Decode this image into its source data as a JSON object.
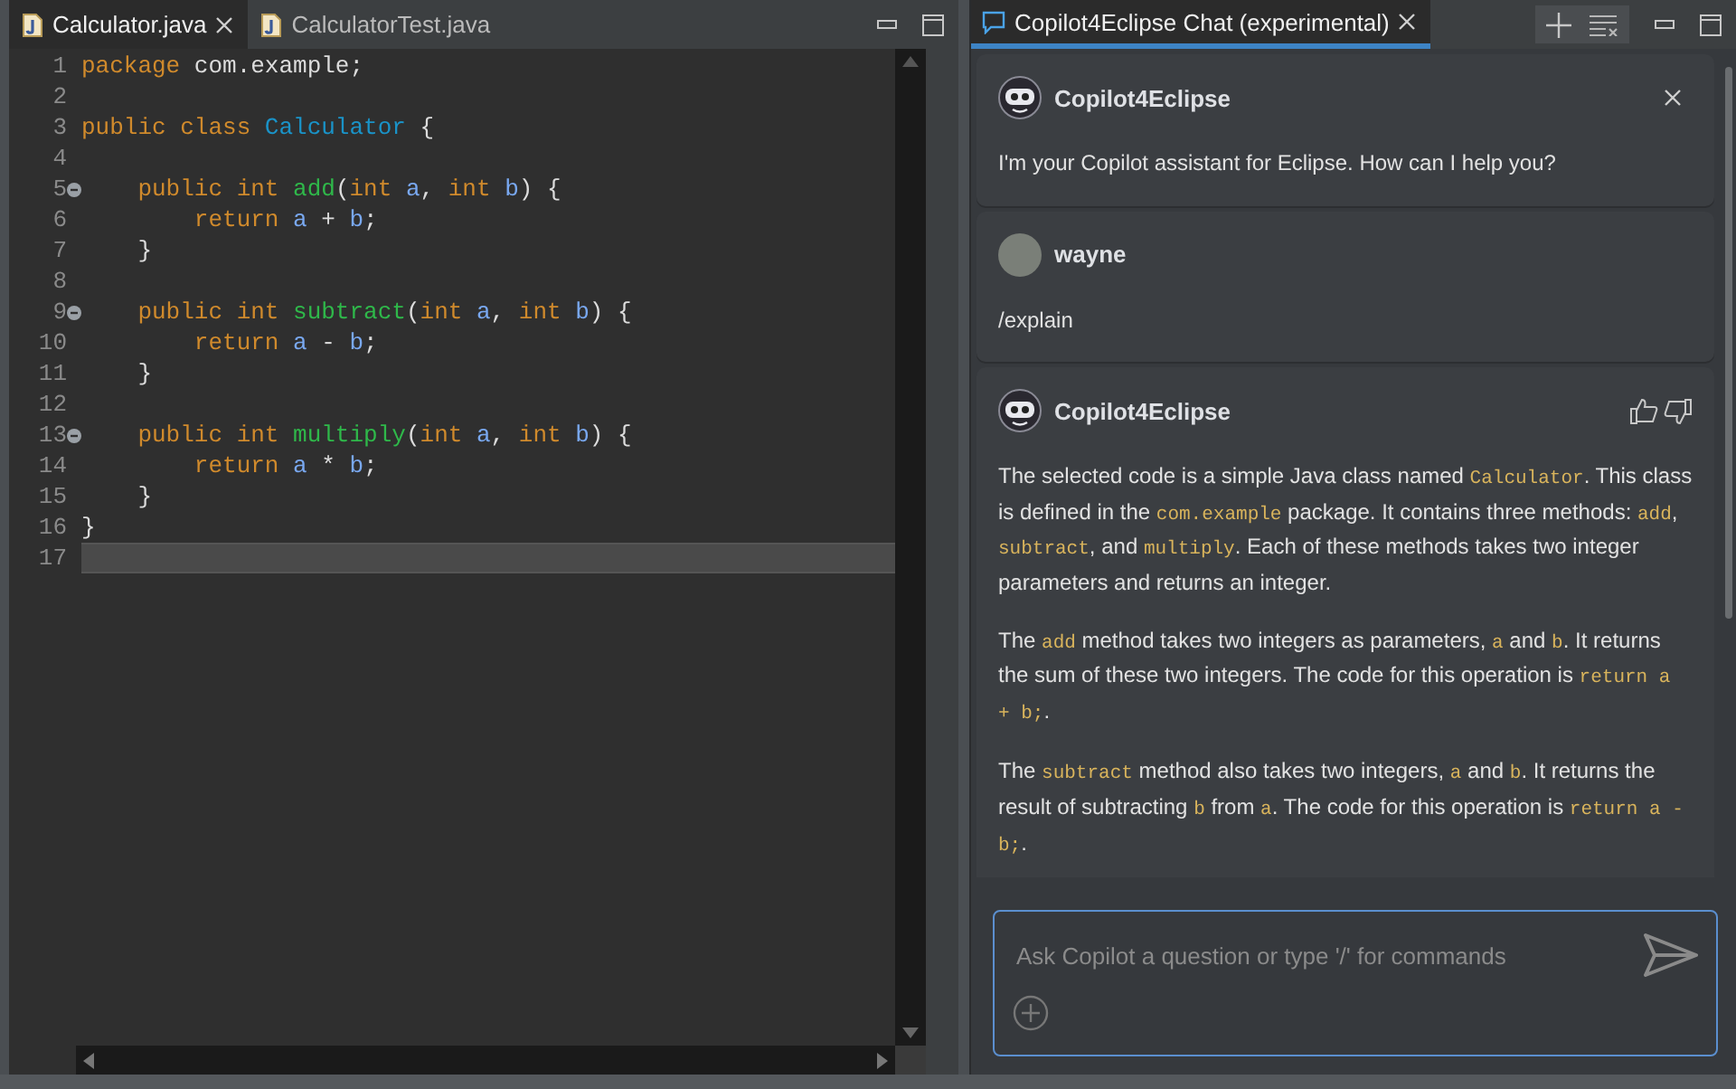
{
  "editor": {
    "tabs": [
      {
        "label": "Calculator.java",
        "selected": true
      },
      {
        "label": "CalculatorTest.java",
        "selected": false
      }
    ],
    "lines": [
      {
        "number": "1",
        "fold": false,
        "current": false,
        "tokens": [
          {
            "t": "package",
            "kind": "keyword"
          },
          {
            "t": " com.example;",
            "kind": "plain"
          }
        ]
      },
      {
        "number": "2",
        "fold": false,
        "current": false
      },
      {
        "number": "3",
        "fold": false,
        "current": false,
        "tokens": [
          {
            "t": "public class ",
            "kind": "keyword"
          },
          {
            "t": "Calculator",
            "kind": "classname"
          },
          {
            "t": " {",
            "kind": "plain"
          }
        ]
      },
      {
        "number": "4",
        "fold": false,
        "current": false
      },
      {
        "number": "5",
        "fold": true,
        "current": false,
        "tokens": [
          {
            "t": "    public int ",
            "kind": "keyword"
          },
          {
            "t": "add",
            "kind": "method"
          },
          {
            "t": "(",
            "kind": "plain"
          },
          {
            "t": "int",
            "kind": "keyword"
          },
          {
            "t": " a",
            "kind": "param"
          },
          {
            "t": ", ",
            "kind": "plain"
          },
          {
            "t": "int",
            "kind": "keyword"
          },
          {
            "t": " b",
            "kind": "param"
          },
          {
            "t": ") {",
            "kind": "plain"
          }
        ]
      },
      {
        "number": "6",
        "fold": false,
        "current": false,
        "tokens": [
          {
            "t": "        return",
            "kind": "keyword"
          },
          {
            "t": " a",
            "kind": "param"
          },
          {
            "t": " + ",
            "kind": "plain"
          },
          {
            "t": "b",
            "kind": "param"
          },
          {
            "t": ";",
            "kind": "plain"
          }
        ]
      },
      {
        "number": "7",
        "fold": false,
        "current": false,
        "tokens": [
          {
            "t": "    }",
            "kind": "plain"
          }
        ]
      },
      {
        "number": "8",
        "fold": false,
        "current": false
      },
      {
        "number": "9",
        "fold": true,
        "current": false,
        "tokens": [
          {
            "t": "    public int ",
            "kind": "keyword"
          },
          {
            "t": "subtract",
            "kind": "method"
          },
          {
            "t": "(",
            "kind": "plain"
          },
          {
            "t": "int",
            "kind": "keyword"
          },
          {
            "t": " a",
            "kind": "param"
          },
          {
            "t": ", ",
            "kind": "plain"
          },
          {
            "t": "int",
            "kind": "keyword"
          },
          {
            "t": " b",
            "kind": "param"
          },
          {
            "t": ") {",
            "kind": "plain"
          }
        ]
      },
      {
        "number": "10",
        "fold": false,
        "current": false,
        "tokens": [
          {
            "t": "        return",
            "kind": "keyword"
          },
          {
            "t": " a",
            "kind": "param"
          },
          {
            "t": " - ",
            "kind": "plain"
          },
          {
            "t": "b",
            "kind": "param"
          },
          {
            "t": ";",
            "kind": "plain"
          }
        ]
      },
      {
        "number": "11",
        "fold": false,
        "current": false,
        "tokens": [
          {
            "t": "    }",
            "kind": "plain"
          }
        ]
      },
      {
        "number": "12",
        "fold": false,
        "current": false
      },
      {
        "number": "13",
        "fold": true,
        "current": false,
        "tokens": [
          {
            "t": "    public int ",
            "kind": "keyword"
          },
          {
            "t": "multiply",
            "kind": "method"
          },
          {
            "t": "(",
            "kind": "plain"
          },
          {
            "t": "int",
            "kind": "keyword"
          },
          {
            "t": " a",
            "kind": "param"
          },
          {
            "t": ", ",
            "kind": "plain"
          },
          {
            "t": "int",
            "kind": "keyword"
          },
          {
            "t": " b",
            "kind": "param"
          },
          {
            "t": ") {",
            "kind": "plain"
          }
        ]
      },
      {
        "number": "14",
        "fold": false,
        "current": false,
        "tokens": [
          {
            "t": "        return",
            "kind": "keyword"
          },
          {
            "t": " a",
            "kind": "param"
          },
          {
            "t": " * ",
            "kind": "plain"
          },
          {
            "t": "b",
            "kind": "param"
          },
          {
            "t": ";",
            "kind": "plain"
          }
        ]
      },
      {
        "number": "15",
        "fold": false,
        "current": false,
        "tokens": [
          {
            "t": "    }",
            "kind": "plain"
          }
        ]
      },
      {
        "number": "16",
        "fold": false,
        "current": false,
        "tokens": [
          {
            "t": "}",
            "kind": "plain"
          }
        ]
      },
      {
        "number": "17",
        "fold": false,
        "current": true
      }
    ]
  },
  "chat": {
    "tab": {
      "label": "Copilot4Eclipse Chat (experimental)",
      "selected": true
    },
    "messages": [
      {
        "kind": "bot",
        "author": "Copilot4Eclipse",
        "close_button": true,
        "feedback_buttons": false,
        "paragraphs": [
          [
            {
              "t": "I'm your Copilot assistant for Eclipse. How can I help you?",
              "kind": "text"
            }
          ]
        ]
      },
      {
        "kind": "user",
        "author": "wayne",
        "close_button": false,
        "feedback_buttons": false,
        "paragraphs": [
          [
            {
              "t": "/explain",
              "kind": "text"
            }
          ]
        ]
      },
      {
        "kind": "bot",
        "author": "Copilot4Eclipse",
        "close_button": false,
        "feedback_buttons": true,
        "paragraphs": [
          [
            {
              "t": "The selected code is a simple Java class named ",
              "kind": "text"
            },
            {
              "t": "Calculator",
              "kind": "code"
            },
            {
              "t": ". This class is defined in the ",
              "kind": "text"
            },
            {
              "t": "com.example",
              "kind": "code"
            },
            {
              "t": " package. It contains three methods: ",
              "kind": "text"
            },
            {
              "t": "add",
              "kind": "code"
            },
            {
              "t": ", ",
              "kind": "text"
            },
            {
              "t": "subtract",
              "kind": "code"
            },
            {
              "t": ", and ",
              "kind": "text"
            },
            {
              "t": "multiply",
              "kind": "code"
            },
            {
              "t": ". Each of these methods takes two integer parameters and returns an integer.",
              "kind": "text"
            }
          ],
          [
            {
              "t": "The ",
              "kind": "text"
            },
            {
              "t": "add",
              "kind": "code"
            },
            {
              "t": " method takes two integers as parameters, ",
              "kind": "text"
            },
            {
              "t": "a",
              "kind": "code"
            },
            {
              "t": " and ",
              "kind": "text"
            },
            {
              "t": "b",
              "kind": "code"
            },
            {
              "t": ". It returns the sum of these two integers. The code for this operation is ",
              "kind": "text"
            },
            {
              "t": "return a + b;",
              "kind": "code"
            },
            {
              "t": ".",
              "kind": "text"
            }
          ],
          [
            {
              "t": "The ",
              "kind": "text"
            },
            {
              "t": "subtract",
              "kind": "code"
            },
            {
              "t": " method also takes two integers, ",
              "kind": "text"
            },
            {
              "t": "a",
              "kind": "code"
            },
            {
              "t": " and ",
              "kind": "text"
            },
            {
              "t": "b",
              "kind": "code"
            },
            {
              "t": ". It returns the result of subtracting ",
              "kind": "text"
            },
            {
              "t": "b",
              "kind": "code"
            },
            {
              "t": " from ",
              "kind": "text"
            },
            {
              "t": "a",
              "kind": "code"
            },
            {
              "t": ". The code for this operation is ",
              "kind": "text"
            },
            {
              "t": "return a - b;",
              "kind": "code"
            },
            {
              "t": ".",
              "kind": "text"
            }
          ]
        ]
      }
    ],
    "input": {
      "placeholder": "Ask Copilot a question or type '/' for commands"
    }
  }
}
